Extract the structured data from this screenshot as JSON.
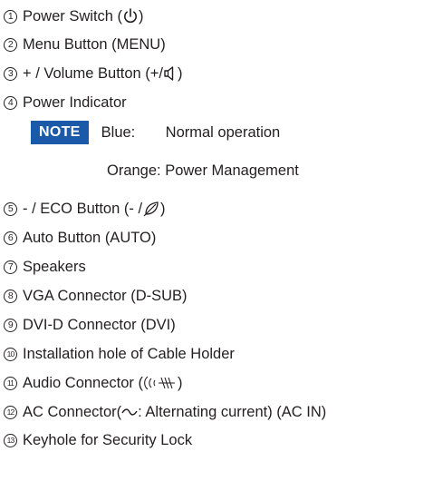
{
  "items": [
    {
      "num": "1",
      "pre": "Power Switch ( ",
      "post": ")",
      "icon": "power-icon"
    },
    {
      "num": "2",
      "text": "Menu Button (MENU)"
    },
    {
      "num": "3",
      "pre": "+ / Volume Button (+/",
      "post": ")",
      "icon": "speaker-icon"
    },
    {
      "num": "4",
      "text": "Power Indicator"
    },
    {
      "num": "5",
      "pre": "- / ECO Button (- / ",
      "post": " )",
      "icon": "eco-leaf-icon"
    },
    {
      "num": "6",
      "text": "Auto Button (AUTO)"
    },
    {
      "num": "7",
      "text": "Speakers"
    },
    {
      "num": "8",
      "text": "VGA Connector (D-SUB)"
    },
    {
      "num": "9",
      "text": "DVI-D Connector (DVI)"
    },
    {
      "num": "10",
      "text": "Installation hole of Cable Holder"
    },
    {
      "num": "11",
      "pre": "Audio Connector ( ",
      "post": " )",
      "icon": "audio-out-icon"
    },
    {
      "num": "12",
      "pre": "AC Connector( ",
      "post": " : Alternating current) (AC IN)",
      "icon": "ac-wave-icon"
    },
    {
      "num": "13",
      "text": "Keyhole for Security Lock"
    }
  ],
  "note": {
    "badge": "NOTE",
    "row1_label": "Blue:",
    "row1_value": "Normal operation",
    "row2": "Orange: Power Management"
  },
  "colors": {
    "note_badge_bg": "#1a5aa8",
    "text": "#231f20"
  }
}
